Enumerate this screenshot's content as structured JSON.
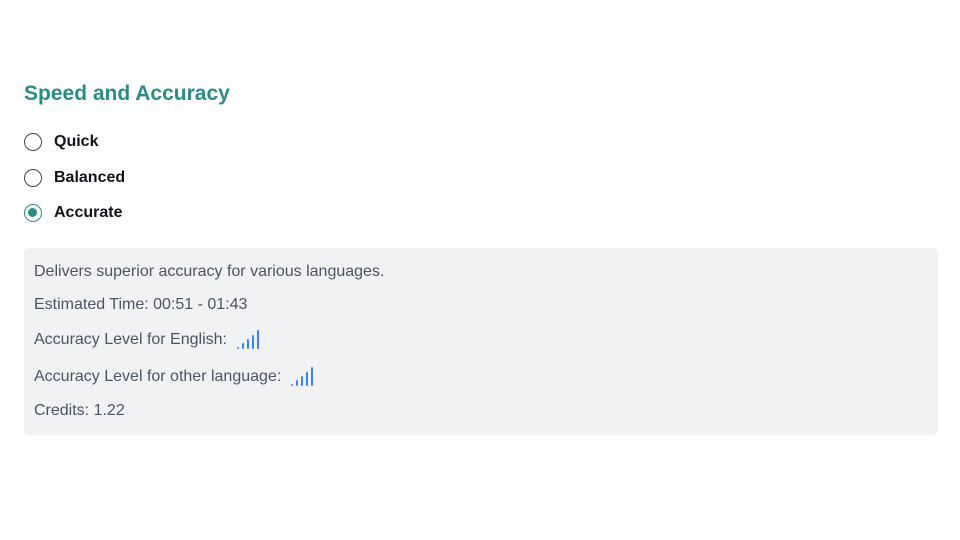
{
  "section": {
    "title": "Speed and Accuracy"
  },
  "options": [
    {
      "label": "Quick",
      "selected": false
    },
    {
      "label": "Balanced",
      "selected": false
    },
    {
      "label": "Accurate",
      "selected": true
    }
  ],
  "details": {
    "description": "Delivers superior accuracy for various languages.",
    "estimated_time": "Estimated Time: 00:51 - 01:43",
    "accuracy_english_label": "Accuracy Level for English:",
    "accuracy_english_level": 4,
    "accuracy_other_label": "Accuracy Level for other language:",
    "accuracy_other_level": 4,
    "accuracy_max_level": 5,
    "credits": "Credits: 1.22"
  },
  "colors": {
    "accent": "#2a8c86",
    "signal": "#3b82f6"
  }
}
